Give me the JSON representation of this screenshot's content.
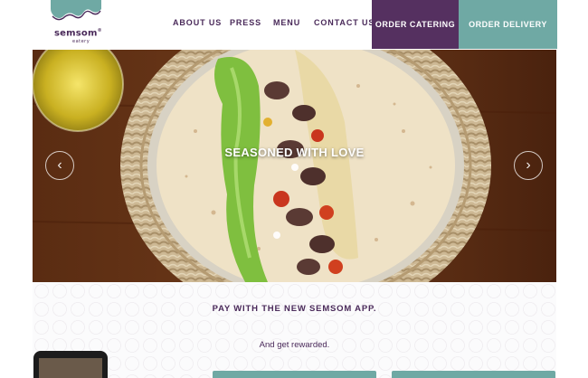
{
  "brand": {
    "name": "semsom",
    "registered": "®",
    "tagline": "eatery",
    "primary_color": "#553060",
    "accent_color": "#6fa9a4"
  },
  "nav": {
    "items": [
      {
        "label": "ABOUT US"
      },
      {
        "label": "PRESS"
      },
      {
        "label": "MENU"
      },
      {
        "label": "CONTACT US"
      }
    ],
    "order_catering": "ORDER CATERING",
    "order_delivery": "ORDER DELIVERY"
  },
  "hero": {
    "caption": "SEASONED WITH LOVE",
    "prev_icon": "chevron-left-icon",
    "next_icon": "chevron-right-icon",
    "prev_glyph": "‹",
    "next_glyph": "›"
  },
  "promo": {
    "title": "PAY WITH THE NEW SEMSOM APP.",
    "subtitle": "And get rewarded."
  }
}
